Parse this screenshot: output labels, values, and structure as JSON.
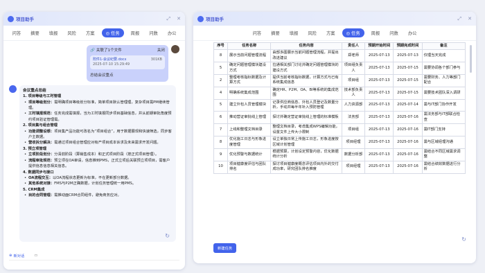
{
  "app": {
    "title": "项目助手"
  },
  "tabs": [
    "问答",
    "摘要",
    "填报",
    "风险",
    "方案",
    "任务",
    "周报",
    "问数",
    "办公"
  ],
  "active_tab": "任务",
  "left": {
    "file_card": {
      "header": "关联了1个文件",
      "close": "关闭",
      "name": "附件1-会议纪要.docx",
      "size": "301KB",
      "date": "2025-07-10 15:29:49"
    },
    "user_message": "总结会议重点",
    "summary": {
      "title": "会议重点总结",
      "sections": [
        {
          "heading": "1. 项目等级与工时管理",
          "items": [
            {
              "k": "项目等级划分：",
              "v": "需明确项目等级划分标准，简单项目默认管理理，复杂项目需PM继续管理。"
            },
            {
              "k": "工时填报规范：",
              "v": "任务完成需填报，当为工时填报同步项目基础信息，并从前期审批角度预约项目验证管理需。"
            }
          ]
        },
        {
          "heading": "2. 项目集与组合管理",
          "items": [
            {
              "k": "功能调整设想：",
              "v": "项目集产品功能可改名为“项目组合”，用于数据展现和快速筛选，同步客户主数据。"
            },
            {
              "k": "营收拆分解决：",
              "v": "需通过项目组合管理应对有产项目成本诉求及未来需求开发问题。"
            }
          ]
        },
        {
          "heading": "3. 预立项管理",
          "items": [
            {
              "k": "立项阶段划分：",
              "v": "分清前阶段（算销售成本）和正式项目阶段（按正式项目管理）。"
            },
            {
              "k": "流程审批规范：",
              "v": "预立项在OA审请，信息推到PMS，正式立项后关联预立项项目，需客户提供信息信息相关信息。"
            }
          ]
        },
        {
          "heading": "4. 数据同步与接口",
          "items": [
            {
              "k": "OA流程交互：",
              "v": "以OA流程状态更新为标准，不在更新部分数据。"
            },
            {
              "k": "其他系统对接：",
              "v": "FMS与P2M正确数据，计划任务管理统一用PMS。"
            }
          ]
        },
        {
          "heading": "5. CRM集成",
          "items": [
            {
              "k": "目的合同管理：",
              "v": "需推动面CRM合同组件，避免商务应对。"
            }
          ]
        }
      ]
    },
    "new_chat": "新对话"
  },
  "right": {
    "headers": [
      "序号",
      "任务名称",
      "任务内容",
      "责任人",
      "预期开始时间",
      "预期完成时间",
      "备注"
    ],
    "rows": [
      [
        "8",
        "展示当前问题管理流程",
        "由部多图展示当前问题管理流程，并提出改进建议",
        "郑老师",
        "2025-07-13",
        "2025-07-13",
        "仅理当天完成"
      ],
      [
        "5",
        "确定问题管理模块建设方式",
        "拉通相关部门讨论并确定问题管理模块的建设方式",
        "项目组负责人",
        "2025-07-13",
        "2025-07-15",
        "需要协调各个部门参与"
      ],
      [
        "2",
        "整理考核指标数据及计算方式",
        "提供当前考核指标数据，计算方式与已有系统集成信息",
        "项目组",
        "2025-07-13",
        "2025-07-15",
        "需要财务、人力等部门配合"
      ],
      [
        "4",
        "明确系统集成范围",
        "确定HR、P2M、OA、BI等系统的集成范围",
        "技术部负责人",
        "2025-07-13",
        "2025-07-15",
        "需要技术团队深入调研"
      ],
      [
        "5",
        "建立外包人员管理模块",
        "记录供应商信息、外包人员登记及数量分析，手动并每半年补入预防管理",
        "人力资源部",
        "2025-07-13",
        "2025-07-14",
        "需与IT部门协作开发"
      ],
      [
        "6",
        "推动营证审批线上管理",
        "探讨并确定营证审批线上管理的标准模板",
        "法务部",
        "2025-07-13",
        "2025-07-16",
        "需法务部与IT部联合检查"
      ],
      [
        "7",
        "上线和整理文档目录",
        "整理文档目录，考虑集成WPS编辑功能，设置文件上传大小限制",
        "项目组",
        "2025-07-13",
        "2025-07-16",
        "需IT部门支持"
      ],
      [
        "8",
        "优化施工日志与形象进度管理",
        "设立单独日常上传施工日志，形象进度按区域计划管理",
        "项目经理",
        "2025-07-13",
        "2025-07-16",
        "需与区域经理沟通"
      ],
      [
        "9",
        "优化预警与数据统计",
        "根据预算，计划设定预警内容，优化数据统计分析",
        "数据分析部",
        "2025-07-13",
        "2025-07-16",
        "需结合不同区域需求调整"
      ],
      [
        "10",
        "项目健康度评估与团队排名",
        "探讨项目健康度概念评估项目内外的交付成功率，研究团队排名推度",
        "项目经理",
        "2025-07-13",
        "2025-07-16",
        "需结合绩效数据进行分析"
      ]
    ],
    "new_task_button": "新建任务"
  },
  "icons": {
    "minimize": "minimize-icon",
    "close": "close-icon",
    "refresh": "refresh-icon"
  }
}
